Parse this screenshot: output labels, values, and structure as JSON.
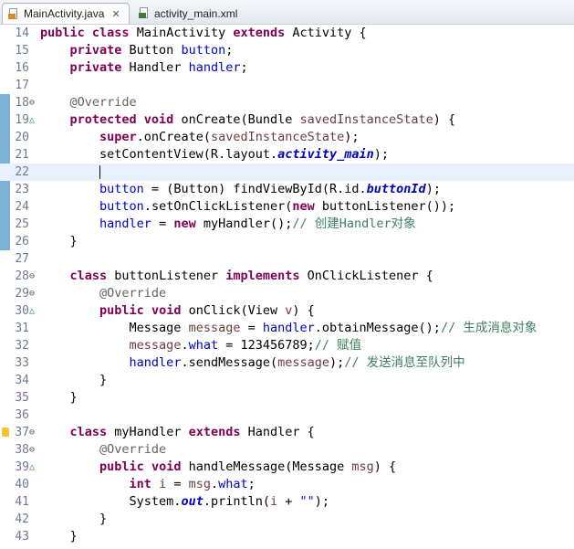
{
  "tabs": [
    {
      "label": "MainActivity.java",
      "icon": "java-file-icon",
      "active": true,
      "closable": true
    },
    {
      "label": "activity_main.xml",
      "icon": "xml-file-icon",
      "active": false,
      "closable": false
    }
  ],
  "tab_close_glyph": "✕",
  "fold_collapse_glyph": "⊖",
  "override_glyph": "△",
  "editor": {
    "current_line": 22,
    "lines": [
      {
        "n": "14",
        "tokens": [
          [
            "kw",
            "public "
          ],
          [
            "kw",
            "class "
          ],
          [
            "",
            "MainActivity "
          ],
          [
            "kw",
            "extends "
          ],
          [
            "",
            "Activity {"
          ]
        ]
      },
      {
        "n": "15",
        "tokens": [
          [
            "",
            "    "
          ],
          [
            "kw",
            "private "
          ],
          [
            "",
            "Button "
          ],
          [
            "fld",
            "button"
          ],
          [
            "",
            ";"
          ]
        ]
      },
      {
        "n": "16",
        "tokens": [
          [
            "",
            "    "
          ],
          [
            "kw",
            "private "
          ],
          [
            "",
            "Handler "
          ],
          [
            "fld",
            "handler"
          ],
          [
            "",
            ";"
          ]
        ]
      },
      {
        "n": "17",
        "tokens": []
      },
      {
        "n": "18",
        "fold": true,
        "tokens": [
          [
            "",
            "    "
          ],
          [
            "ann",
            "@Override"
          ]
        ]
      },
      {
        "n": "19",
        "override": true,
        "tokens": [
          [
            "",
            "    "
          ],
          [
            "kw",
            "protected "
          ],
          [
            "kw",
            "void "
          ],
          [
            "",
            "onCreate(Bundle "
          ],
          [
            "var",
            "savedInstanceState"
          ],
          [
            "",
            ") {"
          ]
        ]
      },
      {
        "n": "20",
        "tokens": [
          [
            "",
            "        "
          ],
          [
            "kw",
            "super"
          ],
          [
            "",
            ".onCreate("
          ],
          [
            "var",
            "savedInstanceState"
          ],
          [
            "",
            ");"
          ]
        ]
      },
      {
        "n": "21",
        "tokens": [
          [
            "",
            "        setContentView(R.layout."
          ],
          [
            "sfld",
            "activity_main"
          ],
          [
            "",
            ");"
          ]
        ]
      },
      {
        "n": "22",
        "cursor": true,
        "tokens": [
          [
            "",
            "        "
          ]
        ]
      },
      {
        "n": "23",
        "tokens": [
          [
            "",
            "        "
          ],
          [
            "fld",
            "button"
          ],
          [
            "",
            " = (Button) findViewById(R.id."
          ],
          [
            "sfld",
            "buttonId"
          ],
          [
            "",
            ");"
          ]
        ]
      },
      {
        "n": "24",
        "tokens": [
          [
            "",
            "        "
          ],
          [
            "fld",
            "button"
          ],
          [
            "",
            ".setOnClickListener("
          ],
          [
            "kw",
            "new "
          ],
          [
            "",
            "buttonListener());"
          ]
        ]
      },
      {
        "n": "25",
        "tokens": [
          [
            "",
            "        "
          ],
          [
            "fld",
            "handler"
          ],
          [
            "",
            " = "
          ],
          [
            "kw",
            "new "
          ],
          [
            "",
            "myHandler();"
          ],
          [
            "cmt",
            "// 创建Handler对象"
          ]
        ]
      },
      {
        "n": "26",
        "tokens": [
          [
            "",
            "    }"
          ]
        ]
      },
      {
        "n": "27",
        "tokens": []
      },
      {
        "n": "28",
        "fold": true,
        "tokens": [
          [
            "",
            "    "
          ],
          [
            "kw",
            "class "
          ],
          [
            "",
            "buttonListener "
          ],
          [
            "kw",
            "implements "
          ],
          [
            "",
            "OnClickListener {"
          ]
        ]
      },
      {
        "n": "29",
        "fold": true,
        "tokens": [
          [
            "",
            "        "
          ],
          [
            "ann",
            "@Override"
          ]
        ]
      },
      {
        "n": "30",
        "override": true,
        "tokens": [
          [
            "",
            "        "
          ],
          [
            "kw",
            "public "
          ],
          [
            "kw",
            "void "
          ],
          [
            "",
            "onClick(View "
          ],
          [
            "var",
            "v"
          ],
          [
            "",
            ") {"
          ]
        ]
      },
      {
        "n": "31",
        "tokens": [
          [
            "",
            "            Message "
          ],
          [
            "var",
            "message"
          ],
          [
            "",
            " = "
          ],
          [
            "fld",
            "handler"
          ],
          [
            "",
            ".obtainMessage();"
          ],
          [
            "cmt",
            "// 生成消息对象"
          ]
        ]
      },
      {
        "n": "32",
        "tokens": [
          [
            "",
            "            "
          ],
          [
            "var",
            "message"
          ],
          [
            "",
            "."
          ],
          [
            "fld",
            "what"
          ],
          [
            "",
            " = 123456789;"
          ],
          [
            "cmt",
            "// 赋值"
          ]
        ]
      },
      {
        "n": "33",
        "tokens": [
          [
            "",
            "            "
          ],
          [
            "fld",
            "handler"
          ],
          [
            "",
            ".sendMessage("
          ],
          [
            "var",
            "message"
          ],
          [
            "",
            ");"
          ],
          [
            "cmt",
            "// 发送消息至队列中"
          ]
        ]
      },
      {
        "n": "34",
        "tokens": [
          [
            "",
            "        }"
          ]
        ]
      },
      {
        "n": "35",
        "tokens": [
          [
            "",
            "    }"
          ]
        ]
      },
      {
        "n": "36",
        "tokens": []
      },
      {
        "n": "37",
        "fold": true,
        "warning": true,
        "tokens": [
          [
            "",
            "    "
          ],
          [
            "kw",
            "class "
          ],
          [
            "",
            "myHandler "
          ],
          [
            "kw",
            "extends "
          ],
          [
            "",
            "Handler {"
          ]
        ]
      },
      {
        "n": "38",
        "fold": true,
        "tokens": [
          [
            "",
            "        "
          ],
          [
            "ann",
            "@Override"
          ]
        ]
      },
      {
        "n": "39",
        "override": true,
        "tokens": [
          [
            "",
            "        "
          ],
          [
            "kw",
            "public "
          ],
          [
            "kw",
            "void "
          ],
          [
            "",
            "handleMessage(Message "
          ],
          [
            "var",
            "msg"
          ],
          [
            "",
            ") {"
          ]
        ]
      },
      {
        "n": "40",
        "tokens": [
          [
            "",
            "            "
          ],
          [
            "kw",
            "int "
          ],
          [
            "var",
            "i"
          ],
          [
            "",
            " = "
          ],
          [
            "var",
            "msg"
          ],
          [
            "",
            "."
          ],
          [
            "fld",
            "what"
          ],
          [
            "",
            ";"
          ]
        ]
      },
      {
        "n": "41",
        "tokens": [
          [
            "",
            "            System."
          ],
          [
            "sfld",
            "out"
          ],
          [
            "",
            ".println("
          ],
          [
            "var",
            "i"
          ],
          [
            "",
            " + "
          ],
          [
            "str",
            "\"\""
          ],
          [
            "",
            ");"
          ]
        ]
      },
      {
        "n": "42",
        "tokens": [
          [
            "",
            "        }"
          ]
        ]
      },
      {
        "n": "43",
        "tokens": [
          [
            "",
            "    }"
          ]
        ]
      }
    ]
  }
}
